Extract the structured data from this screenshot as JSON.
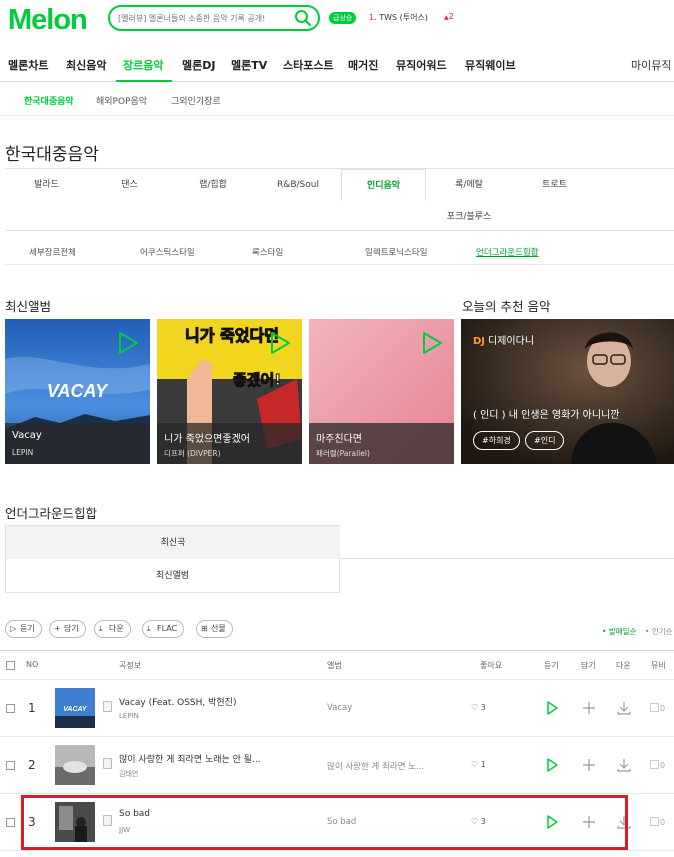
{
  "header": {
    "logo": "Melon",
    "search_placeholder": "[멜러뷰] 멜론너들의 소중한 음악 기록 공개!",
    "rt_badge": "급상승",
    "rt_rank_num": "1.",
    "rt_rank_text": "TWS (투어스)",
    "rt_change": "2"
  },
  "gnb": [
    "멜론차트",
    "최신음악",
    "장르음악",
    "멜론DJ",
    "멜론TV",
    "스타포스트",
    "매거진",
    "뮤직어워드",
    "뮤직웨이브"
  ],
  "gnb_right": "마이뮤직",
  "subnav": [
    "한국대중음악",
    "해외POP음악",
    "그외인기장르"
  ],
  "page_title": "한국대중음악",
  "genre_tabs": [
    "발라드",
    "댄스",
    "랩/힙합",
    "R&B/Soul",
    "인디음악",
    "록/메탈",
    "트로트",
    "포크/블루스"
  ],
  "detail_tabs": [
    "세부장르전체",
    "어쿠스틱스타일",
    "록스타일",
    "일렉트로닉스타일",
    "언더그라운드힙합"
  ],
  "latest_album_title": "최신앨범",
  "albums": [
    {
      "title": "Vacay",
      "artist": "LEPIN",
      "cover_text": "VACAY"
    },
    {
      "title": "니가 죽었으면좋겠어",
      "artist": "디프퍼 (DIVPER)",
      "cover_text_1": "니가 죽었다면",
      "cover_text_2": "좋겠어!"
    },
    {
      "title": "마주친다면",
      "artist": "패러렐(Parallel)"
    }
  ],
  "recommend": {
    "section_title": "오늘의 추천 음악",
    "dj_label": "DJ",
    "dj_name": "디제이다니",
    "title": "( 인디 ) 내 인생은 영화가 아니니깐",
    "tags": [
      "#하희경",
      "#인디"
    ]
  },
  "underground": {
    "title": "언더그라운드힙합",
    "tabs": [
      "최신곡",
      "최신앨범"
    ]
  },
  "toolbar": {
    "buttons": [
      "듣기",
      "담기",
      "다운",
      "FLAC",
      "선물"
    ],
    "sort_active": "발매일순",
    "sort_other": "인기순"
  },
  "table": {
    "headers": {
      "no": "NO",
      "song": "곡정보",
      "album": "앨범",
      "like": "좋아요",
      "play": "듣기",
      "add": "담기",
      "down": "다운",
      "mv": "뮤비"
    },
    "rows": [
      {
        "rank": "1",
        "title": "Vacay (Feat. OSSH, 박현진)",
        "artist": "LEPIN",
        "album": "Vacay",
        "likes": "3",
        "mv": "0"
      },
      {
        "rank": "2",
        "title": "많이 사랑한 게 죄라면 노래는 안 될...",
        "artist": "김태연",
        "album": "많이 사랑한 게 죄라면 노...",
        "likes": "1",
        "mv": "0"
      },
      {
        "rank": "3",
        "title": "So bad",
        "artist": "JJW",
        "album": "So bad",
        "likes": "3",
        "mv": "0"
      }
    ]
  },
  "colors": {
    "brand": "#00cd3c",
    "highlight": "#d91f26"
  }
}
